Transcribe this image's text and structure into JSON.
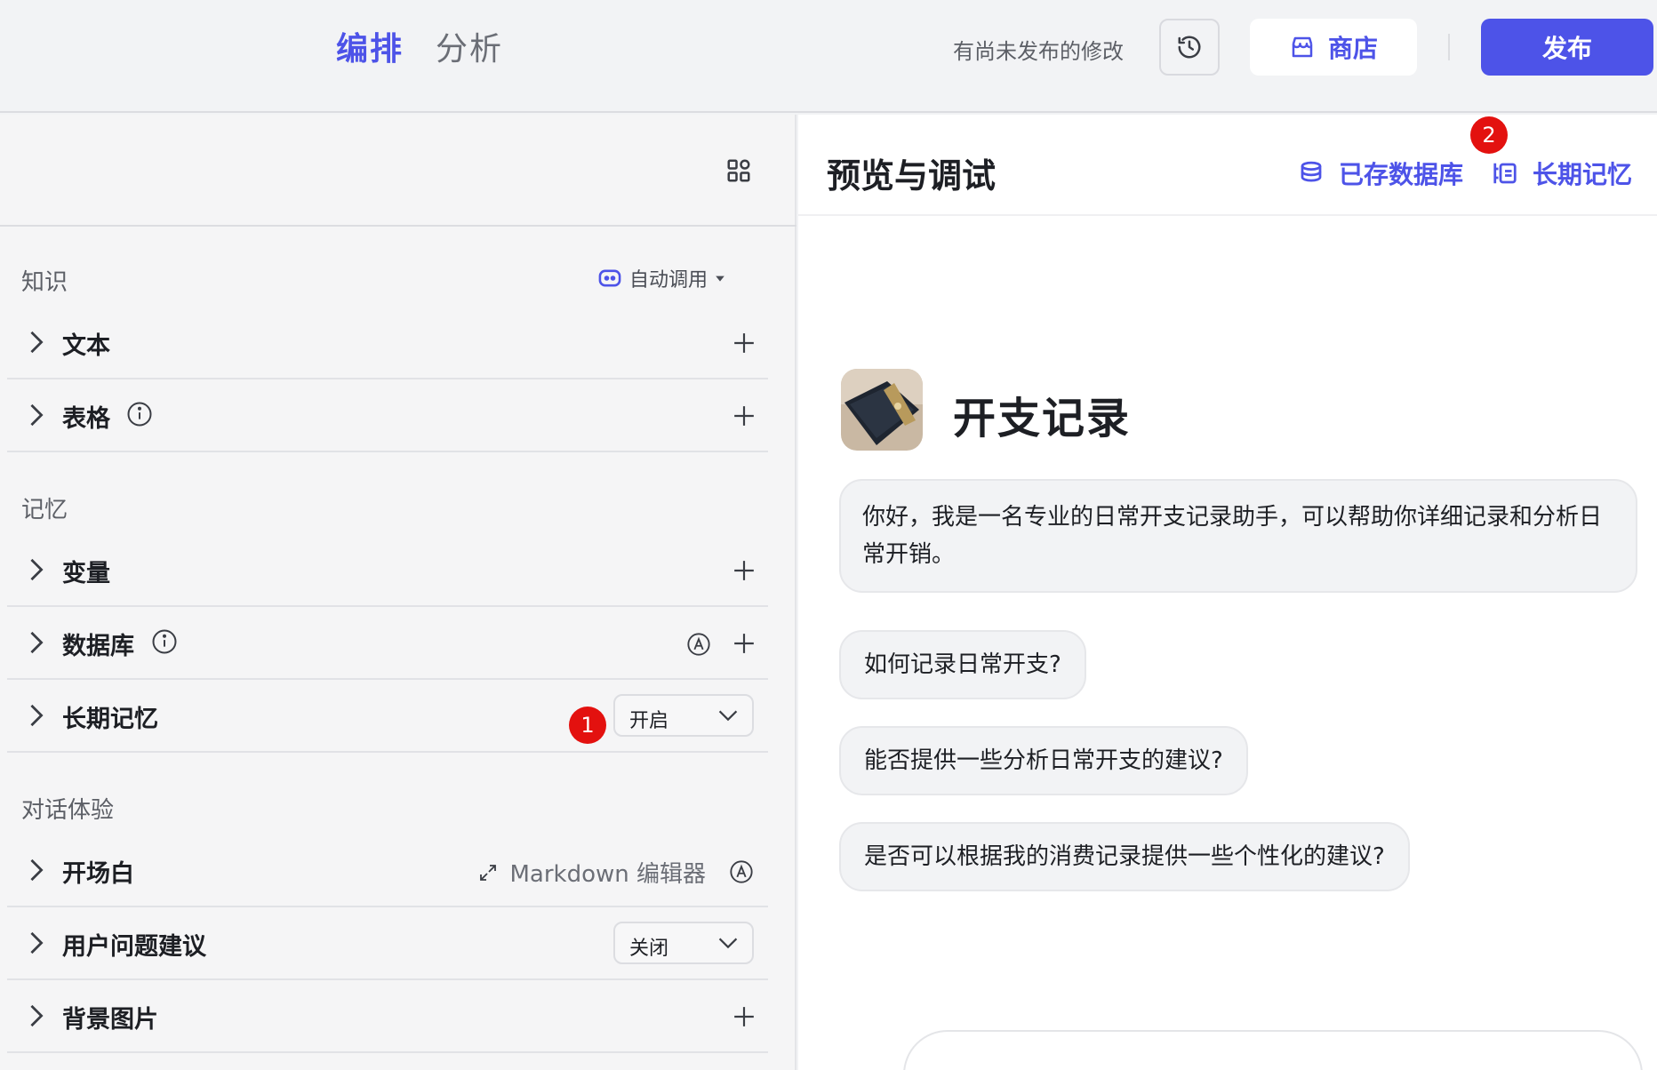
{
  "topbar": {
    "tabs": [
      {
        "label": "编排",
        "active": true
      },
      {
        "label": "分析",
        "active": false
      }
    ],
    "unpublished_notice": "有尚未发布的修改",
    "store_label": "商店",
    "publish_label": "发布",
    "accent_color": "#4d53e8"
  },
  "left": {
    "knowledge": {
      "title": "知识",
      "auto_call": "自动调用",
      "items": [
        {
          "label": "文本"
        },
        {
          "label": "表格"
        }
      ]
    },
    "memory": {
      "title": "记忆",
      "items": [
        {
          "label": "变量"
        },
        {
          "label": "数据库"
        },
        {
          "label": "长期记忆",
          "select_value": "开启"
        }
      ]
    },
    "experience": {
      "title": "对话体验",
      "items": [
        {
          "label": "开场白",
          "editor_label": "Markdown 编辑器"
        },
        {
          "label": "用户问题建议",
          "select_value": "关闭"
        },
        {
          "label": "背景图片"
        }
      ]
    },
    "badge_1": "1"
  },
  "right": {
    "title": "预览与调试",
    "db_link": "已存数据库",
    "memory_link": "长期记忆",
    "badge_2": "2",
    "bot_name": "开支记录",
    "greeting": "你好，我是一名专业的日常开支记录助手，可以帮助你详细记录和分析日常开销。",
    "suggestions": [
      "如何记录日常开支?",
      "能否提供一些分析日常开支的建议?",
      "是否可以根据我的消费记录提供一些个性化的建议?"
    ]
  }
}
